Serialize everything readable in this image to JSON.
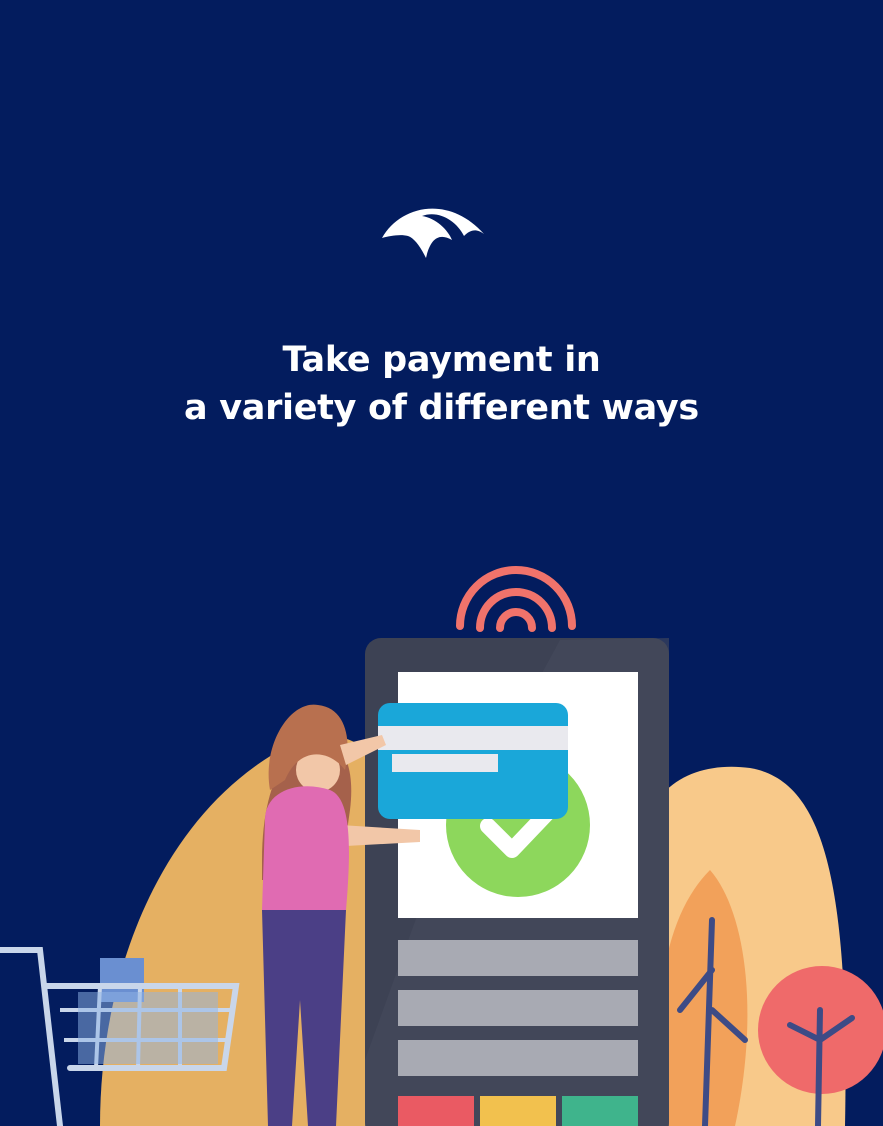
{
  "onboarding": {
    "headline_line1": "Take payment in",
    "headline_line2": "a variety of different ways",
    "logo_icon": "brand-logo-icon",
    "illustration_icon": "card-payment-terminal-illustration"
  },
  "colors": {
    "background": "#031c5e",
    "text": "#ffffff",
    "terminal": "#3d4254",
    "card": "#1aa7d9",
    "check": "#8dd75c",
    "contactless_waves": "#f0736b",
    "key_red": "#ea5a63",
    "key_yellow": "#f2c14e",
    "key_green": "#3fb48c"
  }
}
